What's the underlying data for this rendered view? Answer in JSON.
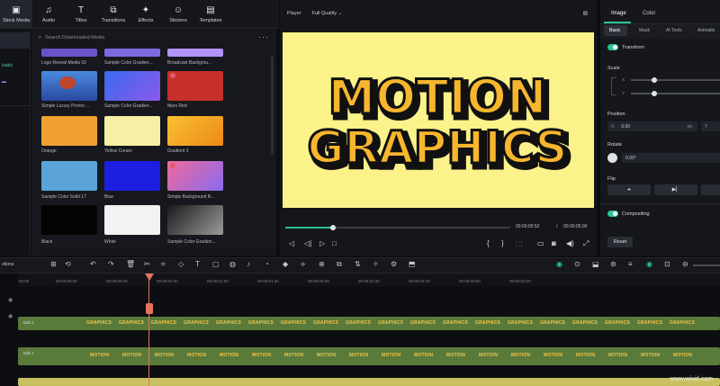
{
  "toolbar": {
    "tabs": [
      {
        "label": "Stock Media",
        "icon": "media-icon"
      },
      {
        "label": "Audio",
        "icon": "music-icon"
      },
      {
        "label": "Titles",
        "icon": "text-icon"
      },
      {
        "label": "Transitions",
        "icon": "transition-icon"
      },
      {
        "label": "Effects",
        "icon": "effects-icon"
      },
      {
        "label": "Stickers",
        "icon": "sticker-icon"
      },
      {
        "label": "Templates",
        "icon": "template-icon"
      }
    ]
  },
  "leftnav": {
    "items": [
      "loads"
    ]
  },
  "media": {
    "search_placeholder": "Search Downloaded Media",
    "items": [
      {
        "label": "Logo Reveal Media 02",
        "color": "#7a5ad8"
      },
      {
        "label": "Sample Color Gradien...",
        "color": "#8a70e8"
      },
      {
        "label": "Broadcast Backgrou...",
        "color": "#c0a0ff"
      },
      {
        "label": "Simple Luxury Promo ...",
        "color": "#3a7ad8"
      },
      {
        "label": "Sample Color Gradien...",
        "color": "#5a5ff0"
      },
      {
        "label": "Mars Red",
        "color": "#c8312b"
      },
      {
        "label": "Orange",
        "color": "#f0a030"
      },
      {
        "label": "Yellow Cream",
        "color": "#f7f0a0"
      },
      {
        "label": "Gradient 3",
        "color": "#f0a020"
      },
      {
        "label": "Sample Color Solid 17",
        "color": "#5aa0d8"
      },
      {
        "label": "Blue",
        "color": "#1c1fe0"
      },
      {
        "label": "Simple Background B...",
        "color": "#e05090"
      },
      {
        "label": "Black",
        "color": "#050505"
      },
      {
        "label": "White",
        "color": "#f2f2f2"
      },
      {
        "label": "Sample Color Gradien...",
        "color": "#6a6a6a"
      }
    ]
  },
  "player": {
    "label": "Player",
    "quality": "Full Quality",
    "title_line1": "MOTION",
    "title_line2": "GRAPHICS",
    "current_time": "00:00:00:52",
    "separator": "/",
    "total_time": "00:00:05:00",
    "progress": 0.2
  },
  "inspector": {
    "tabs": [
      "Image",
      "Color"
    ],
    "subtabs": [
      "Basic",
      "Mask",
      "AI Tools",
      "Animatio"
    ],
    "transform": "Transform",
    "scale": "Scale",
    "x_label": "X",
    "y_label": "Y",
    "position": "Position",
    "pos_x": "0.00",
    "pos_unit": "px",
    "pos_y_label": "Y",
    "rotate": "Rotate",
    "rotate_value": "0.00°",
    "flip": "Flip",
    "compositing": "Compositing",
    "reset": "Reset"
  },
  "timeline": {
    "label": "otions",
    "ticks": [
      "00:00",
      "00:00:00:20",
      "00:00:00:40",
      "00:00:01:00",
      "00:00:01:20",
      "00:00:01:40",
      "00:00:02:00",
      "00:00:02:20",
      "00:00:02:40",
      "00:00:03:00",
      "00:00:03:20"
    ],
    "track2_label": "Edit 2",
    "track1_label": "Edit 1",
    "clip2_word": "GRAPHICS",
    "clip1_word": "MOTION"
  },
  "watermark": "www.wivid.com"
}
